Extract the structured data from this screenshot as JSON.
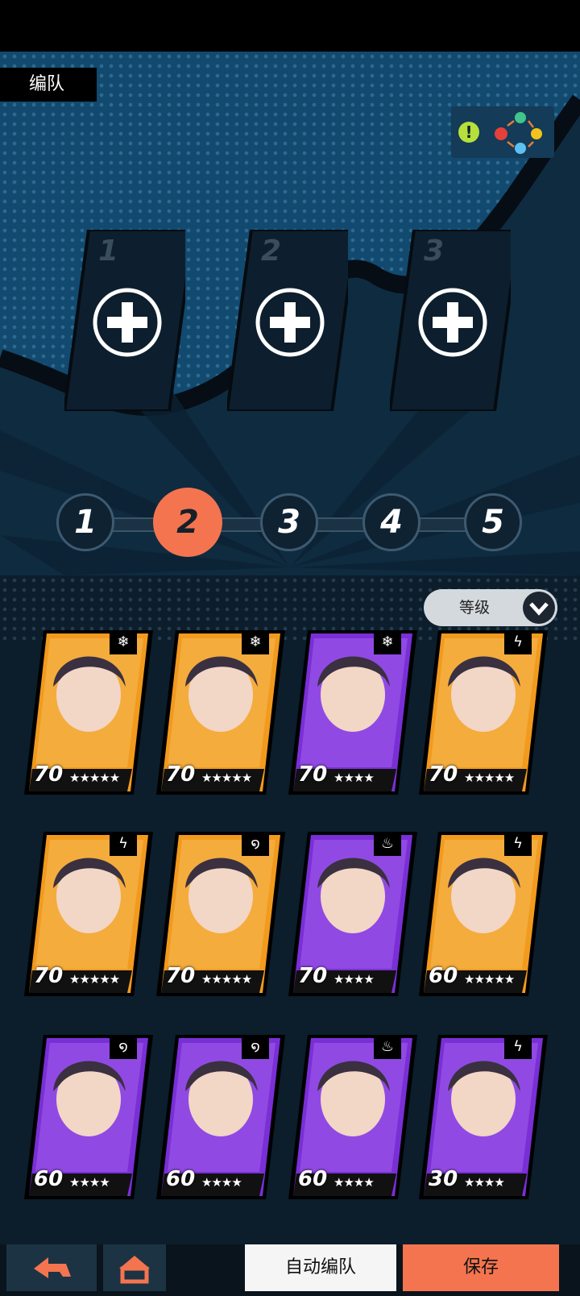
{
  "header": {
    "title": "编队"
  },
  "element_chart": {
    "icon": "element-cycle-icon",
    "alert_icon": "exclamation-icon"
  },
  "slots": [
    {
      "number": "1"
    },
    {
      "number": "2"
    },
    {
      "number": "3"
    }
  ],
  "team_tabs": [
    {
      "label": "1",
      "active": false
    },
    {
      "label": "2",
      "active": true
    },
    {
      "label": "3",
      "active": false
    },
    {
      "label": "4",
      "active": false
    },
    {
      "label": "5",
      "active": false
    }
  ],
  "sort": {
    "label": "等级",
    "icon": "chevron-down-icon"
  },
  "roster": [
    {
      "level": "70",
      "stars": "★★★★★",
      "frame": "orange",
      "element": "snowflake-icon"
    },
    {
      "level": "70",
      "stars": "★★★★★",
      "frame": "orange",
      "element": "snowflake-icon"
    },
    {
      "level": "70",
      "stars": "★★★★",
      "frame": "purple",
      "element": "snowflake-icon"
    },
    {
      "level": "70",
      "stars": "★★★★★",
      "frame": "orange",
      "element": "lightning-icon"
    },
    {
      "level": "70",
      "stars": "★★★★★",
      "frame": "orange",
      "element": "lightning-icon"
    },
    {
      "level": "70",
      "stars": "★★★★★",
      "frame": "orange",
      "element": "wind-icon"
    },
    {
      "level": "70",
      "stars": "★★★★",
      "frame": "purple",
      "element": "fire-icon"
    },
    {
      "level": "60",
      "stars": "★★★★★",
      "frame": "orange",
      "element": "lightning-icon"
    },
    {
      "level": "60",
      "stars": "★★★★",
      "frame": "purple",
      "element": "wind-icon"
    },
    {
      "level": "60",
      "stars": "★★★★",
      "frame": "purple",
      "element": "wind-icon"
    },
    {
      "level": "60",
      "stars": "★★★★",
      "frame": "purple",
      "element": "fire-icon"
    },
    {
      "level": "30",
      "stars": "★★★★",
      "frame": "purple",
      "element": "lightning-icon"
    }
  ],
  "buttons": {
    "auto": "自动编队",
    "save": "保存",
    "back_icon": "back-arrow-icon",
    "home_icon": "home-icon"
  },
  "colors": {
    "accent": "#f4744f",
    "orange_frame": "#f29a1e",
    "purple_frame": "#7a2fd6",
    "background": "#12496f"
  }
}
